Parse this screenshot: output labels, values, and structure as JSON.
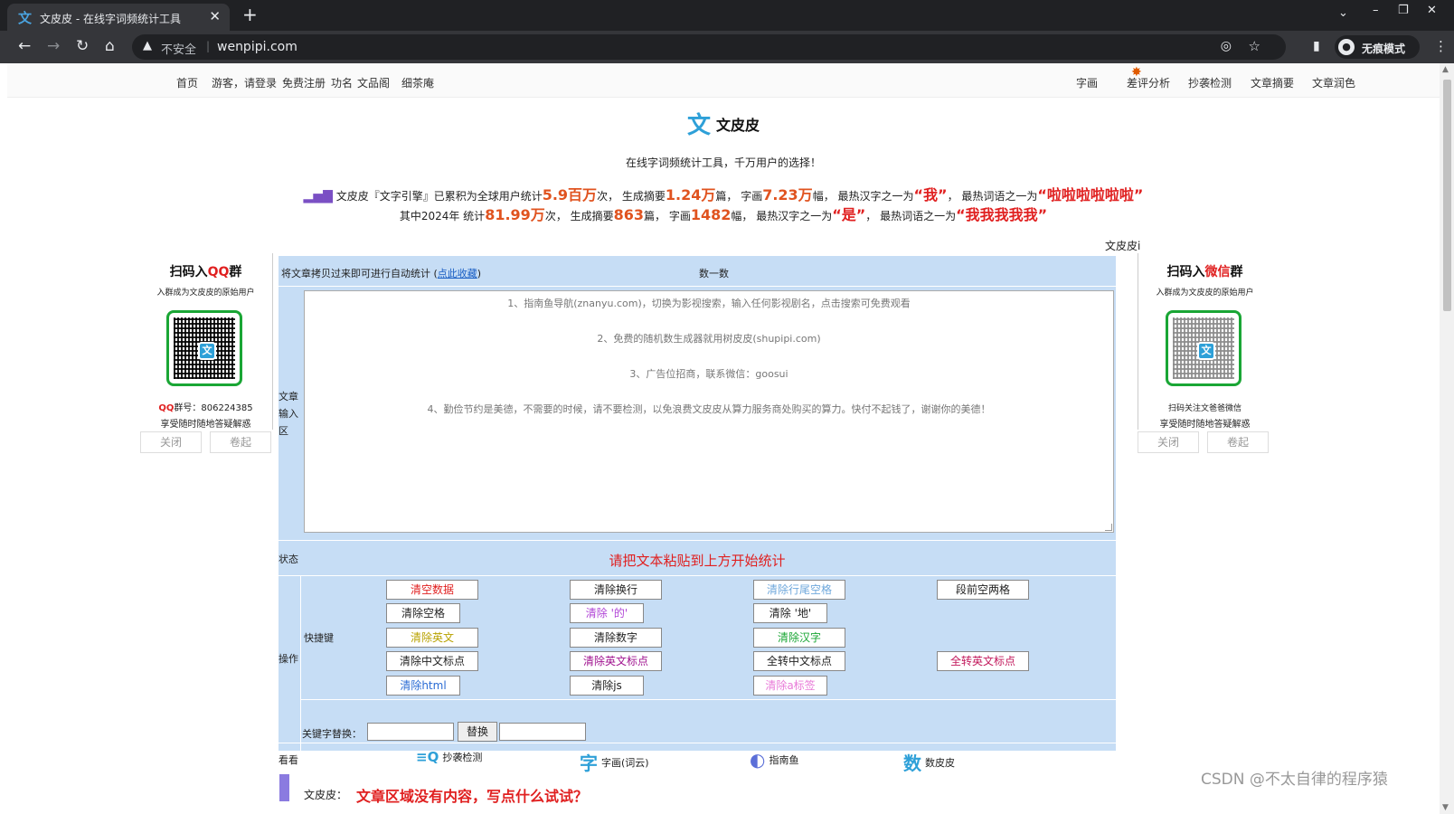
{
  "browser": {
    "tab_title": "文皮皮 - 在线字词频统计工具",
    "tab_icon": "文",
    "url": "wenpipi.com",
    "insecure_label": "不安全",
    "incognito_label": "无痕模式"
  },
  "nav": {
    "left": [
      "首页",
      "游客，请登录",
      "免费注册",
      "功名",
      "文品阁",
      "细茶庵"
    ],
    "right": [
      "字画",
      "差评分析",
      "抄袭检测",
      "文章摘要",
      "文章润色"
    ]
  },
  "brand": {
    "logo": "文",
    "name": "文皮皮",
    "slogan": "在线字词频统计工具，千万用户的选择！"
  },
  "stats": {
    "line1": {
      "p1": "文皮皮『文字引擎』已累积为全球用户统计",
      "v1": "5.9百万",
      "p2": "次， 生成摘要",
      "v2": "1.24万",
      "p3": "篇， 字画",
      "v3": "7.23万",
      "p4": "幅， 最热汉字之一为",
      "w1": "“我”",
      "p5": "， 最热词语之一为",
      "w2": "“啦啦啦啦啦啦”"
    },
    "line2": {
      "p1": "其中2024年 统计",
      "v1": "81.99万",
      "p2": "次， 生成摘要",
      "v2": "863",
      "p3": "篇， 字画",
      "v3": "1482",
      "p4": "幅， 最热汉字之一为",
      "w1": "“是”",
      "p5": "， 最热词语之一为",
      "w2": "“我我我我我”"
    },
    "corner": "文皮皮i"
  },
  "qq_panel": {
    "title_a": "扫码入",
    "title_b": "QQ",
    "title_c": "群",
    "sub": "入群成为文皮皮的原始用户",
    "num_label": "QQ",
    "num_text": "群号：806224385",
    "desc": "享受随时随地答疑解惑",
    "close": "关闭",
    "collapse": "卷起"
  },
  "wx_panel": {
    "title_a": "扫码入",
    "title_b": "微信",
    "title_c": "群",
    "sub": "入群成为文皮皮的原始用户",
    "info1": "扫码关注文爸爸微信",
    "desc": "享受随时随地答疑解惑",
    "close": "关闭",
    "collapse": "卷起"
  },
  "main": {
    "copy_hint_a": "将文章拷贝过来即可进行自动统计 (",
    "bookmark_link": "点此收藏",
    "copy_hint_b": ")",
    "count_title": "数一数",
    "input_label": "文章输入区",
    "placeholder_lines": [
      "1、指南鱼导航(znanyu.com)，切换为影视搜索，输入任何影视剧名，点击搜索可免费观看",
      "2、免费的随机数生成器就用树皮皮(shupipi.com)",
      "3、广告位招商，联系微信：goosui",
      "4、勤俭节约是美德，不需要的时候，请不要检测，以免浪费文皮皮从算力服务商处购买的算力。快付不起钱了，谢谢你的美德！"
    ],
    "status_label": "状态",
    "status_msg": "请把文本粘贴到上方开始统计",
    "ops_label": "操作",
    "shortcut_label": "快捷键",
    "buttons": [
      {
        "label": "清空数据",
        "color": "#e02020"
      },
      {
        "label": "清除换行",
        "color": "#222222"
      },
      {
        "label": "清除行尾空格",
        "color": "#6fa8dc"
      },
      {
        "label": "段前空两格",
        "color": "#222222"
      },
      {
        "label": "清除空格",
        "color": "#222222"
      },
      {
        "label": "清除 '的'",
        "color": "#b044d6"
      },
      {
        "label": "清除 '地'",
        "color": "#222222"
      },
      {
        "label": "清除英文",
        "color": "#b8a200"
      },
      {
        "label": "清除数字",
        "color": "#222222"
      },
      {
        "label": "清除汉字",
        "color": "#1aa635"
      },
      {
        "label": "清除中文标点",
        "color": "#222222"
      },
      {
        "label": "清除英文标点",
        "color": "#a0128f"
      },
      {
        "label": "全转中文标点",
        "color": "#222222"
      },
      {
        "label": "全转英文标点",
        "color": "#c2185b"
      },
      {
        "label": "清除html",
        "color": "#2b6cd4"
      },
      {
        "label": "清除js",
        "color": "#222222"
      },
      {
        "label": "清除a标签",
        "color": "#e87ad8"
      }
    ],
    "keyword_label": "关键字替换：",
    "replace_btn": "替换",
    "see_label": "看看",
    "see_items": [
      {
        "glyph": "≡Q",
        "label": "抄袭检测"
      },
      {
        "glyph": "字",
        "label": "字画(词云)"
      },
      {
        "glyph": "◐",
        "label": "指南鱼"
      },
      {
        "glyph": "数",
        "label": "数皮皮"
      }
    ],
    "bottom_label": "文皮皮：",
    "bottom_msg": "文章区域没有内容，写点什么试试？"
  },
  "watermark": "CSDN @不太自律的程序猿"
}
